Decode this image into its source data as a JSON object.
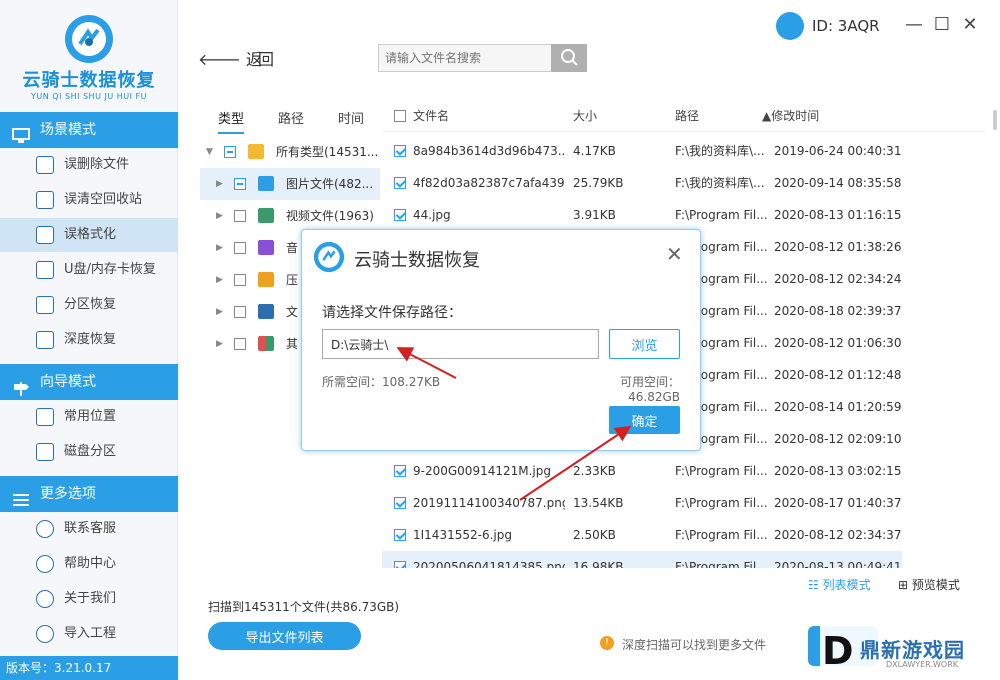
{
  "app": {
    "logo_cn": "云骑士数据恢复",
    "logo_pinyin": "YUN QI SHI SHU JU HUI FU",
    "version": "版本号：3.21.0.17"
  },
  "sidebar": {
    "sections": [
      {
        "label": "场景模式",
        "items": [
          "误删除文件",
          "误清空回收站",
          "误格式化",
          "U盘/内存卡恢复",
          "分区恢复",
          "深度恢复"
        ]
      },
      {
        "label": "向导模式",
        "items": [
          "常用位置",
          "磁盘分区"
        ]
      },
      {
        "label": "更多选项",
        "items": [
          "联系客服",
          "帮助中心",
          "关于我们",
          "导入工程"
        ]
      }
    ],
    "active_item": "误格式化"
  },
  "header": {
    "back_label": "返",
    "forward_label": "回",
    "search_placeholder": "请输入文件名搜索",
    "user_id": "ID: 3AQR",
    "win_min": "—",
    "win_max": "☐",
    "win_close": "✕"
  },
  "tree": {
    "tabs": [
      "类型",
      "路径",
      "时间"
    ],
    "rows": [
      {
        "label": "所有类型(14531...",
        "icon": "folder-icon",
        "icon_color": "#f5b830"
      },
      {
        "label": "图片文件(482...",
        "icon": "image-icon",
        "icon_color": "#2b9fe6"
      },
      {
        "label": "视频文件(1963)",
        "icon": "video-icon",
        "icon_color": "#3a9a6a"
      },
      {
        "label": "音",
        "icon": "music-icon",
        "icon_color": "#8a4fd8"
      },
      {
        "label": "压",
        "icon": "zip-icon",
        "icon_color": "#f0a020"
      },
      {
        "label": "文",
        "icon": "document-icon",
        "icon_color": "#2b6fb0"
      },
      {
        "label": "其",
        "icon": "other-icon",
        "icon_color": "#e05050"
      }
    ]
  },
  "list": {
    "headers": {
      "name": "文件名",
      "size": "大小",
      "path": "路径",
      "time": "修改时间"
    },
    "rows": [
      {
        "name": "8a984b3614d3d96b473...",
        "size": "4.17KB",
        "path": "F:\\我的资料库\\...",
        "time": "2019-06-24 00:40:31"
      },
      {
        "name": "4f82d03a82387c7afa439...",
        "size": "25.79KB",
        "path": "F:\\我的资料库\\...",
        "time": "2020-09-14 08:35:58"
      },
      {
        "name": "44.jpg",
        "size": "3.91KB",
        "path": "F:\\Program Fil...",
        "time": "2020-08-13 01:16:15"
      },
      {
        "name": "",
        "size": "",
        "path": "F:\\Program Fil...",
        "time": "2020-08-12 01:38:26"
      },
      {
        "name": "",
        "size": "",
        "path": "F:\\Program Fil...",
        "time": "2020-08-12 02:34:24"
      },
      {
        "name": "",
        "size": "",
        "path": "F:\\Program Fil...",
        "time": "2020-08-18 02:39:37"
      },
      {
        "name": "",
        "size": "",
        "path": "F:\\Program Fil...",
        "time": "2020-08-12 01:06:30"
      },
      {
        "name": "",
        "size": "",
        "path": "F:\\Program Fil...",
        "time": "2020-08-12 01:12:48"
      },
      {
        "name": "",
        "size": "",
        "path": "F:\\Program Fil...",
        "time": "2020-08-14 01:20:59"
      },
      {
        "name": "",
        "size": "",
        "path": "F:\\Program Fil...",
        "time": "2020-08-12 02:09:10"
      },
      {
        "name": "9-200G00914121M.jpg",
        "size": "2.33KB",
        "path": "F:\\Program Fil...",
        "time": "2020-08-13 03:02:15"
      },
      {
        "name": "20191114100340787.png",
        "size": "13.54KB",
        "path": "F:\\Program Fil...",
        "time": "2020-08-17 01:40:37"
      },
      {
        "name": "1I1431552-6.jpg",
        "size": "2.50KB",
        "path": "F:\\Program Fil...",
        "time": "2020-08-12 02:34:37"
      },
      {
        "name": "20200506041814385.png",
        "size": "16.98KB",
        "path": "F:\\Program Fil...",
        "time": "2020-08-13 00:49:41"
      }
    ]
  },
  "footer": {
    "list_mode": "列表模式",
    "preview_mode": "预览模式",
    "scan_info": "扫描到145311个文件(共86.73GB)",
    "export_label": "导出文件列表",
    "hint": "深度扫描可以找到更多文件",
    "hint_icon": "!"
  },
  "dialog": {
    "title": "云骑士数据恢复",
    "close": "✕",
    "label": "请选择文件保存路径：",
    "path_value": "D:\\云骑士\\",
    "browse_label": "浏览",
    "need_space": "所需空间：108.27KB",
    "avail_space": "可用空间：46.82GB",
    "ok_label": "确定"
  },
  "watermark": {
    "cn": "鼎新游戏园",
    "en": "DXLAWYER.WORK",
    "letter": "D"
  }
}
